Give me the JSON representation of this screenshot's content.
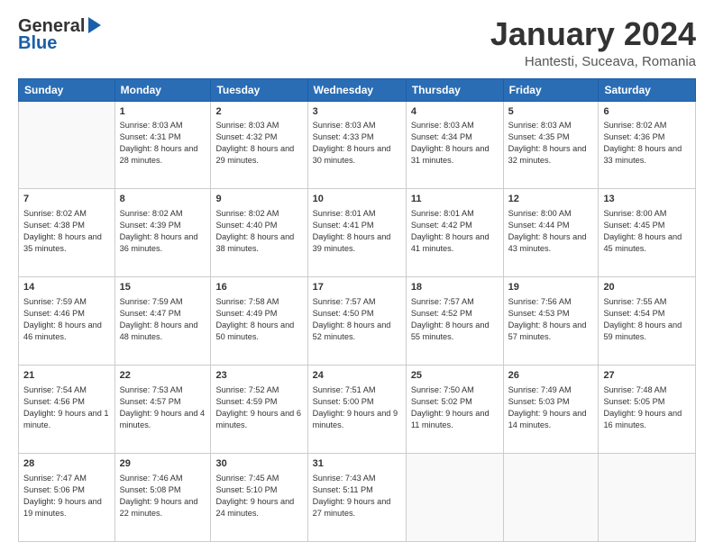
{
  "header": {
    "logo_general": "General",
    "logo_blue": "Blue",
    "month_title": "January 2024",
    "location": "Hantesti, Suceava, Romania"
  },
  "days_of_week": [
    "Sunday",
    "Monday",
    "Tuesday",
    "Wednesday",
    "Thursday",
    "Friday",
    "Saturday"
  ],
  "weeks": [
    [
      {
        "day": "",
        "sunrise": "",
        "sunset": "",
        "daylight": ""
      },
      {
        "day": "1",
        "sunrise": "Sunrise: 8:03 AM",
        "sunset": "Sunset: 4:31 PM",
        "daylight": "Daylight: 8 hours and 28 minutes."
      },
      {
        "day": "2",
        "sunrise": "Sunrise: 8:03 AM",
        "sunset": "Sunset: 4:32 PM",
        "daylight": "Daylight: 8 hours and 29 minutes."
      },
      {
        "day": "3",
        "sunrise": "Sunrise: 8:03 AM",
        "sunset": "Sunset: 4:33 PM",
        "daylight": "Daylight: 8 hours and 30 minutes."
      },
      {
        "day": "4",
        "sunrise": "Sunrise: 8:03 AM",
        "sunset": "Sunset: 4:34 PM",
        "daylight": "Daylight: 8 hours and 31 minutes."
      },
      {
        "day": "5",
        "sunrise": "Sunrise: 8:03 AM",
        "sunset": "Sunset: 4:35 PM",
        "daylight": "Daylight: 8 hours and 32 minutes."
      },
      {
        "day": "6",
        "sunrise": "Sunrise: 8:02 AM",
        "sunset": "Sunset: 4:36 PM",
        "daylight": "Daylight: 8 hours and 33 minutes."
      }
    ],
    [
      {
        "day": "7",
        "sunrise": "Sunrise: 8:02 AM",
        "sunset": "Sunset: 4:38 PM",
        "daylight": "Daylight: 8 hours and 35 minutes."
      },
      {
        "day": "8",
        "sunrise": "Sunrise: 8:02 AM",
        "sunset": "Sunset: 4:39 PM",
        "daylight": "Daylight: 8 hours and 36 minutes."
      },
      {
        "day": "9",
        "sunrise": "Sunrise: 8:02 AM",
        "sunset": "Sunset: 4:40 PM",
        "daylight": "Daylight: 8 hours and 38 minutes."
      },
      {
        "day": "10",
        "sunrise": "Sunrise: 8:01 AM",
        "sunset": "Sunset: 4:41 PM",
        "daylight": "Daylight: 8 hours and 39 minutes."
      },
      {
        "day": "11",
        "sunrise": "Sunrise: 8:01 AM",
        "sunset": "Sunset: 4:42 PM",
        "daylight": "Daylight: 8 hours and 41 minutes."
      },
      {
        "day": "12",
        "sunrise": "Sunrise: 8:00 AM",
        "sunset": "Sunset: 4:44 PM",
        "daylight": "Daylight: 8 hours and 43 minutes."
      },
      {
        "day": "13",
        "sunrise": "Sunrise: 8:00 AM",
        "sunset": "Sunset: 4:45 PM",
        "daylight": "Daylight: 8 hours and 45 minutes."
      }
    ],
    [
      {
        "day": "14",
        "sunrise": "Sunrise: 7:59 AM",
        "sunset": "Sunset: 4:46 PM",
        "daylight": "Daylight: 8 hours and 46 minutes."
      },
      {
        "day": "15",
        "sunrise": "Sunrise: 7:59 AM",
        "sunset": "Sunset: 4:47 PM",
        "daylight": "Daylight: 8 hours and 48 minutes."
      },
      {
        "day": "16",
        "sunrise": "Sunrise: 7:58 AM",
        "sunset": "Sunset: 4:49 PM",
        "daylight": "Daylight: 8 hours and 50 minutes."
      },
      {
        "day": "17",
        "sunrise": "Sunrise: 7:57 AM",
        "sunset": "Sunset: 4:50 PM",
        "daylight": "Daylight: 8 hours and 52 minutes."
      },
      {
        "day": "18",
        "sunrise": "Sunrise: 7:57 AM",
        "sunset": "Sunset: 4:52 PM",
        "daylight": "Daylight: 8 hours and 55 minutes."
      },
      {
        "day": "19",
        "sunrise": "Sunrise: 7:56 AM",
        "sunset": "Sunset: 4:53 PM",
        "daylight": "Daylight: 8 hours and 57 minutes."
      },
      {
        "day": "20",
        "sunrise": "Sunrise: 7:55 AM",
        "sunset": "Sunset: 4:54 PM",
        "daylight": "Daylight: 8 hours and 59 minutes."
      }
    ],
    [
      {
        "day": "21",
        "sunrise": "Sunrise: 7:54 AM",
        "sunset": "Sunset: 4:56 PM",
        "daylight": "Daylight: 9 hours and 1 minute."
      },
      {
        "day": "22",
        "sunrise": "Sunrise: 7:53 AM",
        "sunset": "Sunset: 4:57 PM",
        "daylight": "Daylight: 9 hours and 4 minutes."
      },
      {
        "day": "23",
        "sunrise": "Sunrise: 7:52 AM",
        "sunset": "Sunset: 4:59 PM",
        "daylight": "Daylight: 9 hours and 6 minutes."
      },
      {
        "day": "24",
        "sunrise": "Sunrise: 7:51 AM",
        "sunset": "Sunset: 5:00 PM",
        "daylight": "Daylight: 9 hours and 9 minutes."
      },
      {
        "day": "25",
        "sunrise": "Sunrise: 7:50 AM",
        "sunset": "Sunset: 5:02 PM",
        "daylight": "Daylight: 9 hours and 11 minutes."
      },
      {
        "day": "26",
        "sunrise": "Sunrise: 7:49 AM",
        "sunset": "Sunset: 5:03 PM",
        "daylight": "Daylight: 9 hours and 14 minutes."
      },
      {
        "day": "27",
        "sunrise": "Sunrise: 7:48 AM",
        "sunset": "Sunset: 5:05 PM",
        "daylight": "Daylight: 9 hours and 16 minutes."
      }
    ],
    [
      {
        "day": "28",
        "sunrise": "Sunrise: 7:47 AM",
        "sunset": "Sunset: 5:06 PM",
        "daylight": "Daylight: 9 hours and 19 minutes."
      },
      {
        "day": "29",
        "sunrise": "Sunrise: 7:46 AM",
        "sunset": "Sunset: 5:08 PM",
        "daylight": "Daylight: 9 hours and 22 minutes."
      },
      {
        "day": "30",
        "sunrise": "Sunrise: 7:45 AM",
        "sunset": "Sunset: 5:10 PM",
        "daylight": "Daylight: 9 hours and 24 minutes."
      },
      {
        "day": "31",
        "sunrise": "Sunrise: 7:43 AM",
        "sunset": "Sunset: 5:11 PM",
        "daylight": "Daylight: 9 hours and 27 minutes."
      },
      {
        "day": "",
        "sunrise": "",
        "sunset": "",
        "daylight": ""
      },
      {
        "day": "",
        "sunrise": "",
        "sunset": "",
        "daylight": ""
      },
      {
        "day": "",
        "sunrise": "",
        "sunset": "",
        "daylight": ""
      }
    ]
  ]
}
